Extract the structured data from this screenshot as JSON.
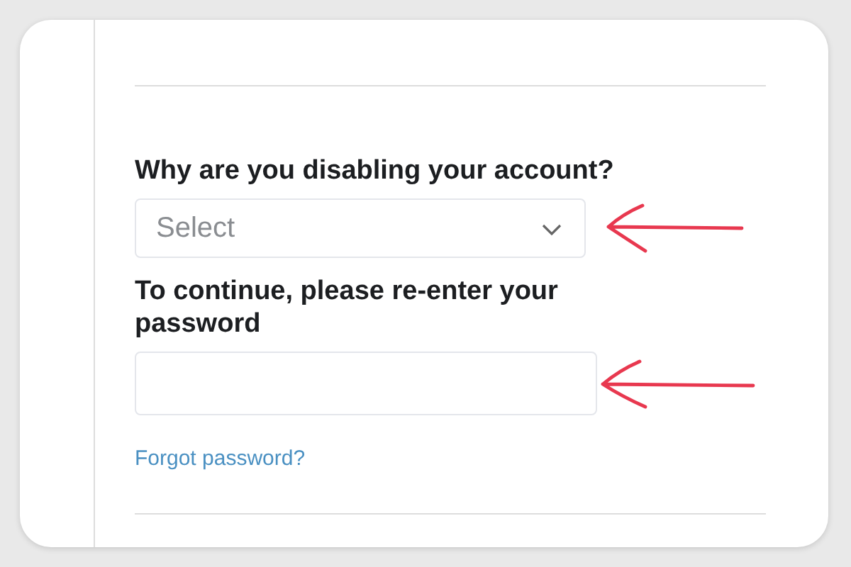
{
  "form": {
    "reason_label": "Why are you disabling your account?",
    "reason_select": {
      "placeholder": "Select"
    },
    "password_label": "To continue, please re-enter your password",
    "forgot_link": "Forgot password?"
  }
}
